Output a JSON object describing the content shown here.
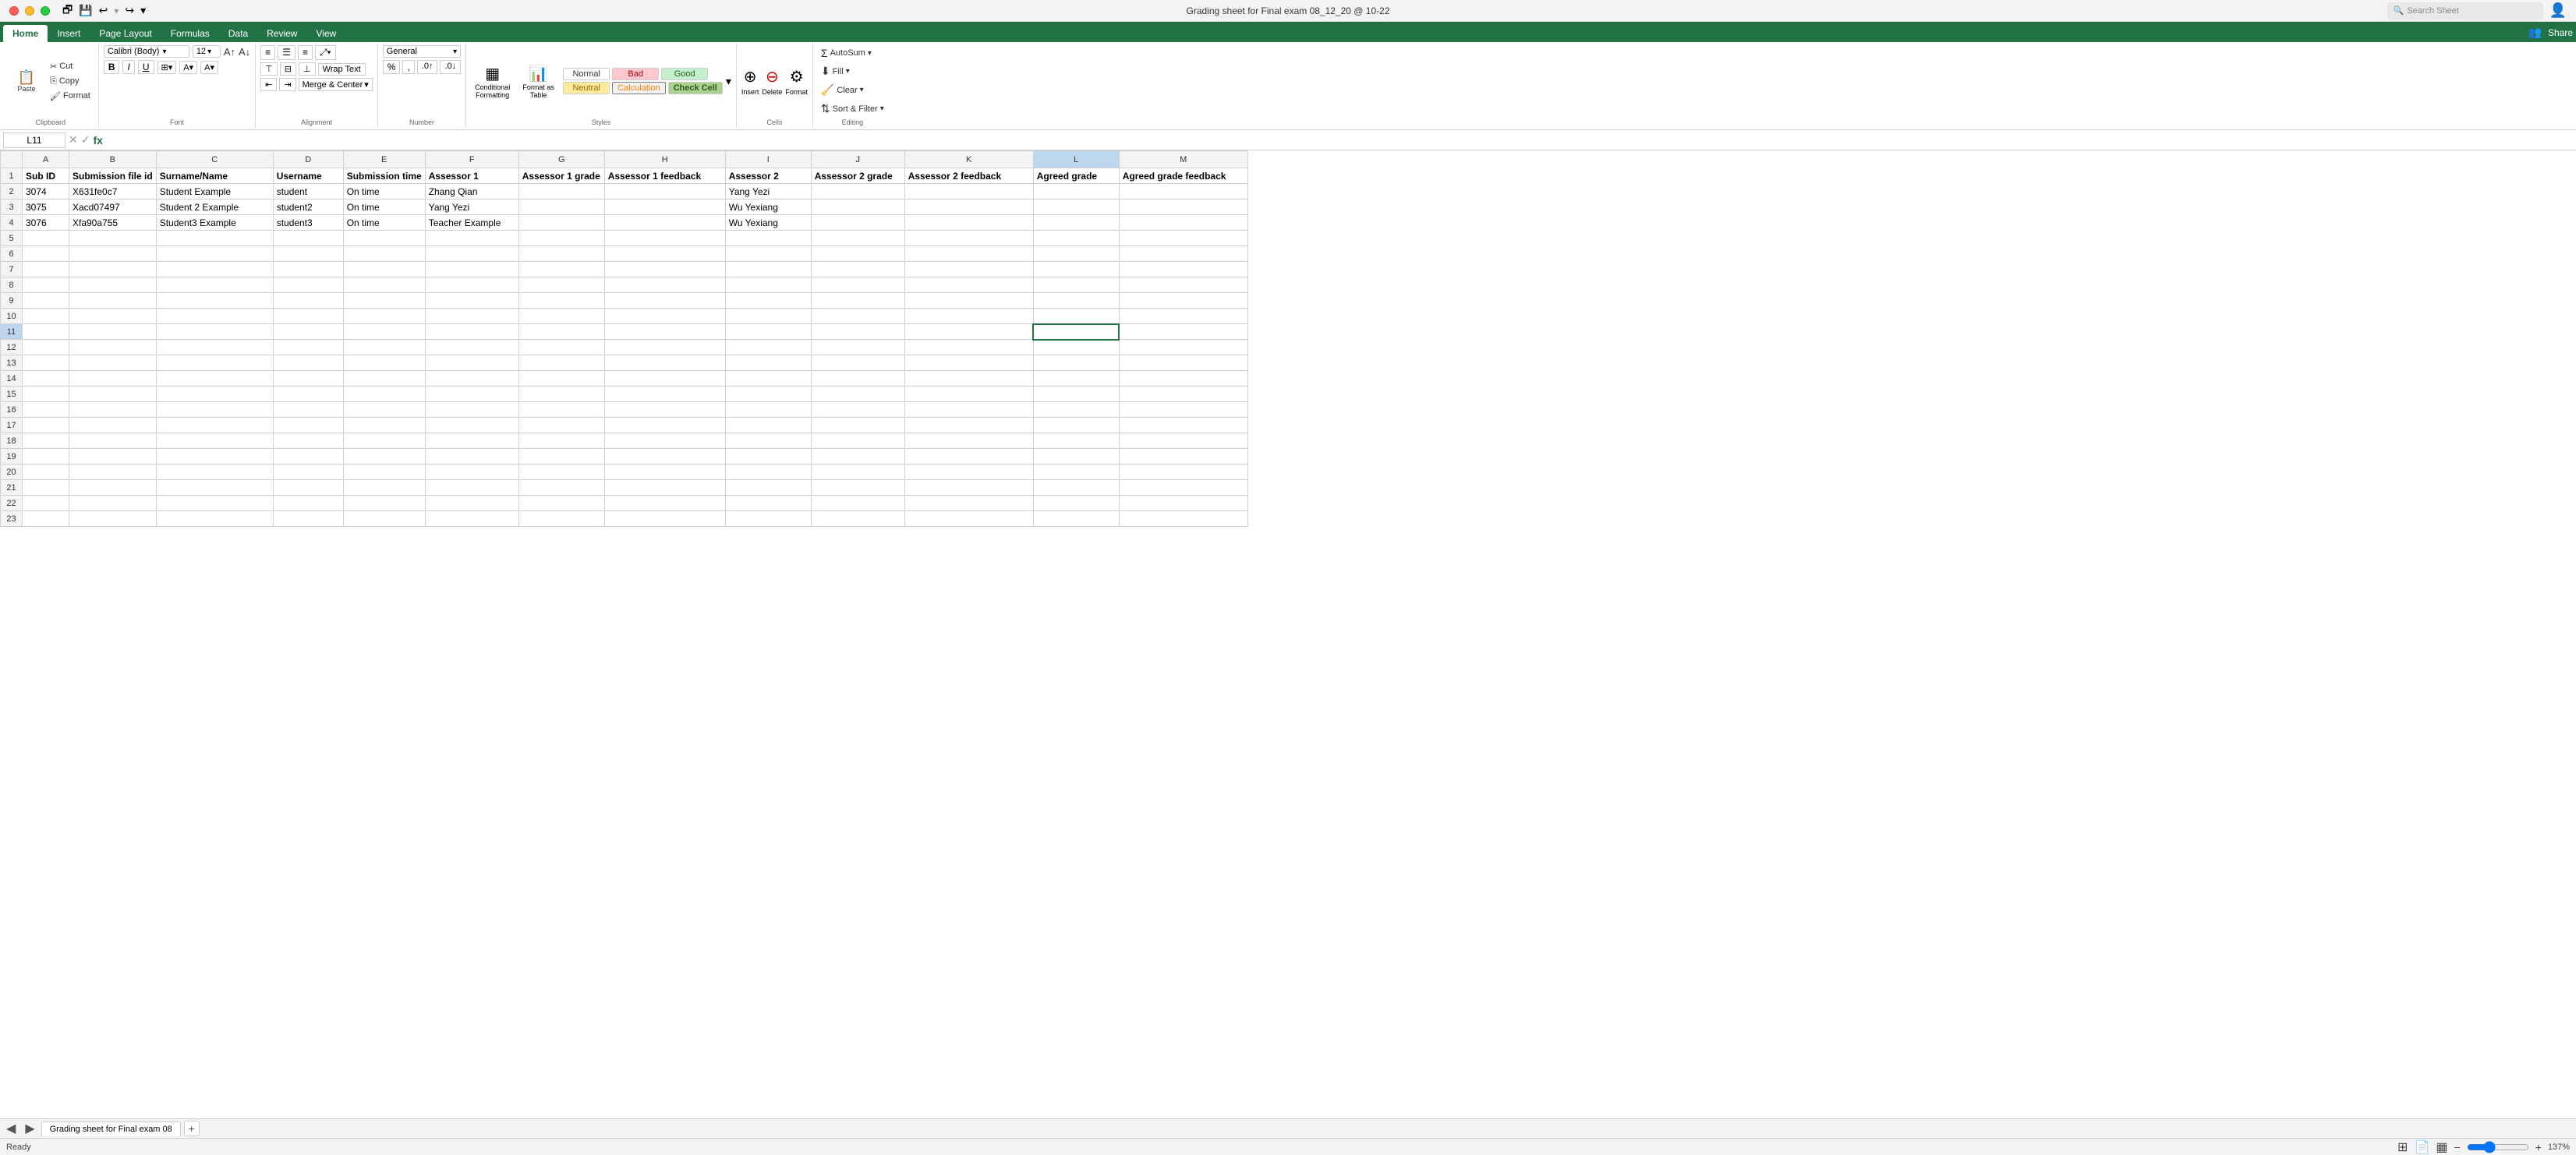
{
  "titleBar": {
    "title": "Grading sheet for Final exam 08_12_20 @ 10-22",
    "search_placeholder": "Search Sheet"
  },
  "ribbonTabs": {
    "tabs": [
      "Home",
      "Insert",
      "Page Layout",
      "Formulas",
      "Data",
      "Review",
      "View"
    ],
    "active": "Home"
  },
  "ribbon": {
    "clipboard": {
      "label": "Clipboard",
      "paste_label": "Paste",
      "cut_label": "Cut",
      "copy_label": "Copy",
      "format_painter_label": "Format"
    },
    "font": {
      "label": "Font",
      "font_name": "Calibri (Body)",
      "font_size": "12",
      "bold": "B",
      "italic": "I",
      "underline": "U"
    },
    "alignment": {
      "label": "Alignment",
      "wrap_text": "Wrap Text",
      "merge_center": "Merge & Center"
    },
    "number": {
      "label": "Number",
      "format": "General"
    },
    "styles": {
      "label": "Styles",
      "conditional_formatting": "Conditional Formatting",
      "format_as_table": "Format as Table",
      "normal": "Normal",
      "bad": "Bad",
      "good": "Good",
      "neutral": "Neutral",
      "calculation": "Calculation",
      "check_cell": "Check Cell"
    },
    "cells": {
      "label": "Cells",
      "insert": "Insert",
      "delete": "Delete",
      "format": "Format"
    },
    "editing": {
      "label": "Editing",
      "autosum": "AutoSum",
      "fill": "Fill",
      "clear": "Clear",
      "sort_filter": "Sort & Filter"
    }
  },
  "formulaBar": {
    "nameBox": "L11",
    "formula": ""
  },
  "grid": {
    "columns": [
      "",
      "A",
      "B",
      "C",
      "D",
      "E",
      "F",
      "G",
      "H",
      "I",
      "J",
      "K",
      "L",
      "M"
    ],
    "rows": [
      [
        "1",
        "Sub ID",
        "Submission file id",
        "Surname/Name",
        "Username",
        "Submission time",
        "Assessor 1",
        "Assessor 1 grade",
        "Assessor 1 feedback",
        "Assessor 2",
        "Assessor 2 grade",
        "Assessor 2 feedback",
        "Agreed grade",
        "Agreed grade feedback"
      ],
      [
        "2",
        "3074",
        "X631fe0c7",
        "Student Example",
        "student",
        "On time",
        "Zhang Qian",
        "",
        "",
        "Yang Yezi",
        "",
        "",
        "",
        ""
      ],
      [
        "3",
        "3075",
        "Xacd07497",
        "Student 2 Example",
        "student2",
        "On time",
        "Yang Yezi",
        "",
        "",
        "Wu Yexiang",
        "",
        "",
        "",
        ""
      ],
      [
        "4",
        "3076",
        "Xfa90a755",
        "Student3 Example",
        "student3",
        "On time",
        "Teacher Example",
        "",
        "",
        "Wu Yexiang",
        "",
        "",
        "",
        ""
      ],
      [
        "5",
        "",
        "",
        "",
        "",
        "",
        "",
        "",
        "",
        "",
        "",
        "",
        "",
        ""
      ],
      [
        "6",
        "",
        "",
        "",
        "",
        "",
        "",
        "",
        "",
        "",
        "",
        "",
        "",
        ""
      ],
      [
        "7",
        "",
        "",
        "",
        "",
        "",
        "",
        "",
        "",
        "",
        "",
        "",
        "",
        ""
      ],
      [
        "8",
        "",
        "",
        "",
        "",
        "",
        "",
        "",
        "",
        "",
        "",
        "",
        "",
        ""
      ],
      [
        "9",
        "",
        "",
        "",
        "",
        "",
        "",
        "",
        "",
        "",
        "",
        "",
        "",
        ""
      ],
      [
        "10",
        "",
        "",
        "",
        "",
        "",
        "",
        "",
        "",
        "",
        "",
        "",
        "",
        ""
      ],
      [
        "11",
        "",
        "",
        "",
        "",
        "",
        "",
        "",
        "",
        "",
        "",
        "",
        "",
        ""
      ],
      [
        "12",
        "",
        "",
        "",
        "",
        "",
        "",
        "",
        "",
        "",
        "",
        "",
        "",
        ""
      ],
      [
        "13",
        "",
        "",
        "",
        "",
        "",
        "",
        "",
        "",
        "",
        "",
        "",
        "",
        ""
      ],
      [
        "14",
        "",
        "",
        "",
        "",
        "",
        "",
        "",
        "",
        "",
        "",
        "",
        "",
        ""
      ],
      [
        "15",
        "",
        "",
        "",
        "",
        "",
        "",
        "",
        "",
        "",
        "",
        "",
        "",
        ""
      ],
      [
        "16",
        "",
        "",
        "",
        "",
        "",
        "",
        "",
        "",
        "",
        "",
        "",
        "",
        ""
      ],
      [
        "17",
        "",
        "",
        "",
        "",
        "",
        "",
        "",
        "",
        "",
        "",
        "",
        "",
        ""
      ],
      [
        "18",
        "",
        "",
        "",
        "",
        "",
        "",
        "",
        "",
        "",
        "",
        "",
        "",
        ""
      ],
      [
        "19",
        "",
        "",
        "",
        "",
        "",
        "",
        "",
        "",
        "",
        "",
        "",
        "",
        ""
      ],
      [
        "20",
        "",
        "",
        "",
        "",
        "",
        "",
        "",
        "",
        "",
        "",
        "",
        "",
        ""
      ],
      [
        "21",
        "",
        "",
        "",
        "",
        "",
        "",
        "",
        "",
        "",
        "",
        "",
        "",
        ""
      ],
      [
        "22",
        "",
        "",
        "",
        "",
        "",
        "",
        "",
        "",
        "",
        "",
        "",
        "",
        ""
      ],
      [
        "23",
        "",
        "",
        "",
        "",
        "",
        "",
        "",
        "",
        "",
        "",
        "",
        "",
        ""
      ]
    ],
    "selectedCell": "L11"
  },
  "sheetTabs": {
    "tabs": [
      "Grading sheet for Final exam 08"
    ],
    "active": "Grading sheet for Final exam 08"
  },
  "statusBar": {
    "status": "Ready",
    "zoom": "137%"
  },
  "icons": {
    "search": "🔍",
    "cut": "✂",
    "copy": "⎘",
    "paste": "📋",
    "bold": "B",
    "italic": "I",
    "underline": "U",
    "undo": "↩",
    "redo": "↪",
    "save": "💾",
    "open": "📂",
    "autosum": "Σ",
    "sort": "⇅",
    "filter": "▽",
    "grid_normal": "⊞",
    "grid_page": "📄",
    "grid_custom": "▦",
    "zoom_out": "−",
    "zoom_in": "+"
  }
}
